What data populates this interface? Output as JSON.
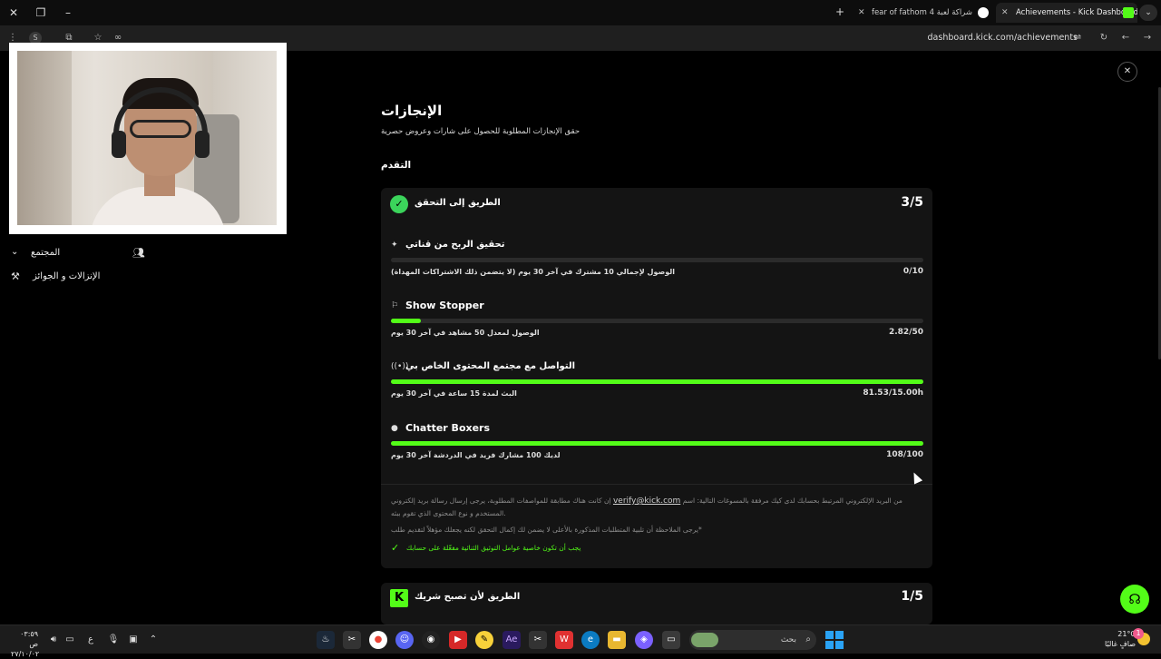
{
  "browser": {
    "tabs": [
      {
        "title": "Achievements - Kick Dashboard",
        "active": true
      },
      {
        "title": "شراكة لعبة fear of fathom 4 - بحث",
        "active": false
      }
    ],
    "url": "dashboard.kick.com/achievements"
  },
  "sidebar": {
    "community_label": "المجتمع",
    "awards_label": "الإنزالات و الجوائز"
  },
  "page": {
    "title": "الإنجازات",
    "subtitle": "حقق الإنجازات المطلوبة للحصول على شارات وعروض حصرية",
    "progress_heading": "التقدم"
  },
  "card_verification": {
    "title": "الطريق إلى التحقق",
    "count": "3/5",
    "achievements": [
      {
        "name": "تحقيق الربح من قناتي",
        "icon": "sparkle-icon",
        "description": "الوصول لإجمالي 10 مشترك في آخر 30 يوم (لا يتضمن ذلك الاشتراكات المهداة)",
        "value": "0/10",
        "progress": 0
      },
      {
        "name": "Show Stopper",
        "icon": "show-stopper-icon",
        "description": "الوصول لمعدل 50 مشاهد في آخر 30 يوم",
        "value": "2.82/50",
        "progress": 0.0564
      },
      {
        "name": "التواصل مع مجتمع المحتوى الخاص بي",
        "icon": "broadcast-icon",
        "description": "البث لمدة 15 ساعة في آخر 30 يوم",
        "value": "81.53/15.00h",
        "progress": 1
      },
      {
        "name": "Chatter Boxers",
        "icon": "chat-bubble-icon",
        "description": "لديك 100 مشارك فريد في الدردشة آخر 30 يوم",
        "value": "108/100",
        "progress": 1
      }
    ],
    "note_before_link": "إن كانت هناك مطابقة للمواصفات المطلوبة، يرجى إرسال رسالة بريد إلكتروني",
    "email": "verify@kick.com",
    "note_after_link": "من البريد الإلكتروني المرتبط بحسابك لدى كيك مرفقة بالمسوغات التالية: اسم المستخدم و نوع المحتوى الذي تقوم ببثه.",
    "note2": "يرجى الملاحظة أن تلبية المتطلبات المذكورة بالأعلى لا يضمن لك إكمال التحقق لكنه يجعلك مؤهلاً لتقديم طلب*",
    "requirement": "يجب أن تكون خاصية عوامل التوثيق الثنائية مفعّلة على حسابك"
  },
  "card_partner": {
    "title": "الطريق لأن تصبح شريك",
    "count": "1/5"
  },
  "taskbar": {
    "time": "٠٣:٥٩ ص",
    "date": "٢٧/١٠/٠٢",
    "search_label": "بحث",
    "weather_temp": "21°C",
    "weather_desc": "صافٍ غالبًا",
    "notifications": "1",
    "lang": "ع"
  },
  "colors": {
    "accent": "#53fc18",
    "verified": "#3bd45b",
    "card_bg": "#141414",
    "track": "#2b2b2b"
  }
}
